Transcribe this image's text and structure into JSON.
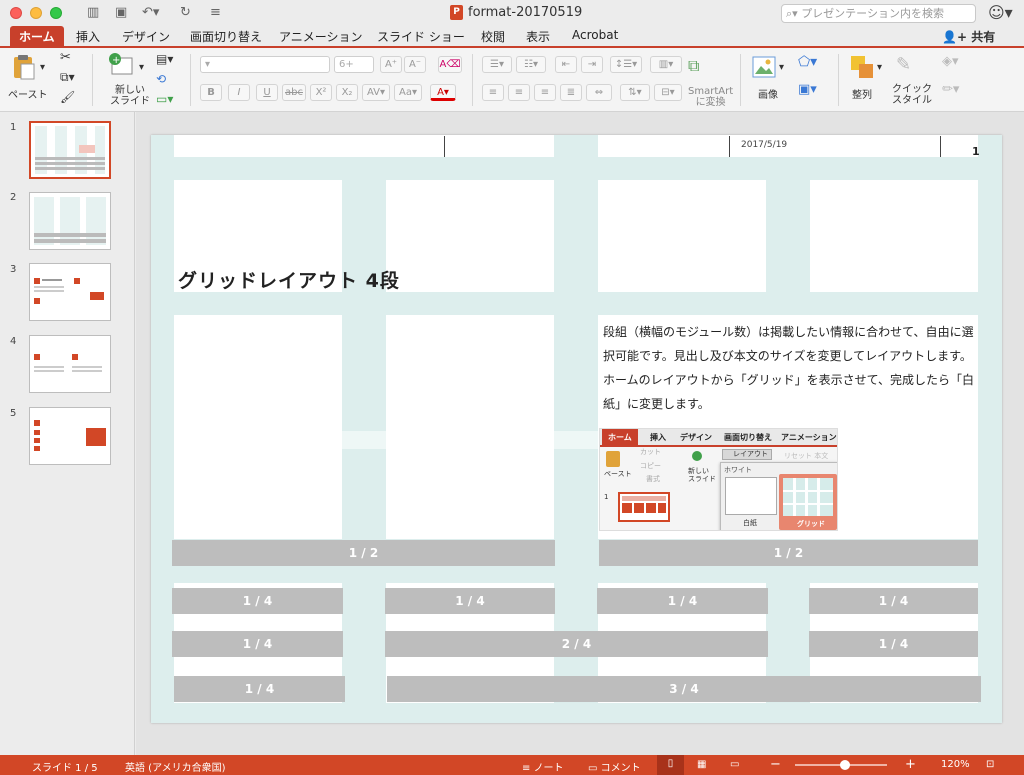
{
  "window": {
    "title": "format-20170519",
    "search_placeholder": "プレゼンテーション内を検索"
  },
  "tabs": [
    "ホーム",
    "挿入",
    "デザイン",
    "画面切り替え",
    "アニメーション",
    "スライド ショー",
    "校閲",
    "表示",
    "Acrobat"
  ],
  "share_label": "共有",
  "ribbon": {
    "paste": "ペースト",
    "new_slide_l1": "新しい",
    "new_slide_l2": "スライド",
    "font_size": "6+",
    "smartart_l1": "SmartArt",
    "smartart_l2": "に変換",
    "image": "画像",
    "arrange": "整列",
    "quick_style_l1": "クイック",
    "quick_style_l2": "スタイル"
  },
  "thumbnails": [
    "1",
    "2",
    "3",
    "4",
    "5"
  ],
  "slide": {
    "date": "2017/5/19",
    "page": "1",
    "title": "グリッドレイアウト 4段",
    "body": "段組（横幅のモジュール数）は掲載したい情報に合わせて、自由に選択可能です。見出し及び本文のサイズを変更してレイアウトします。ホームのレイアウトから「グリッド」を表示させて、完成したら「白紙」に変更します。",
    "bars": {
      "half_left": "1 / 2",
      "half_right": "1 / 2",
      "r1": [
        "1 / 4",
        "1 / 4",
        "1 / 4",
        "1 / 4"
      ],
      "r2": [
        "1 / 4",
        "2 / 4",
        "1 / 4"
      ],
      "r3": [
        "1 / 4",
        "3 / 4"
      ]
    },
    "embedded": {
      "tabs": [
        "ホーム",
        "挿入",
        "デザイン",
        "画面切り替え",
        "アニメーション"
      ],
      "paste": "ペースト",
      "cut": "カット",
      "copy": "コピー",
      "format": "書式",
      "new_slide": "新しい\nスライド",
      "layout": "レイアウト",
      "layout_dim": "リセット 本文",
      "white": "ホワイト",
      "blank": "白紙",
      "grid": "グリッド",
      "slide_num": "1"
    }
  },
  "status": {
    "slide": "スライド 1 / 5",
    "language": "英語 (アメリカ合衆国)",
    "notes": "ノート",
    "comments": "コメント",
    "zoom": "120%"
  },
  "colors": {
    "accent": "#d24726",
    "grid": "#ddeeed",
    "bar": "#bdbdbd"
  }
}
